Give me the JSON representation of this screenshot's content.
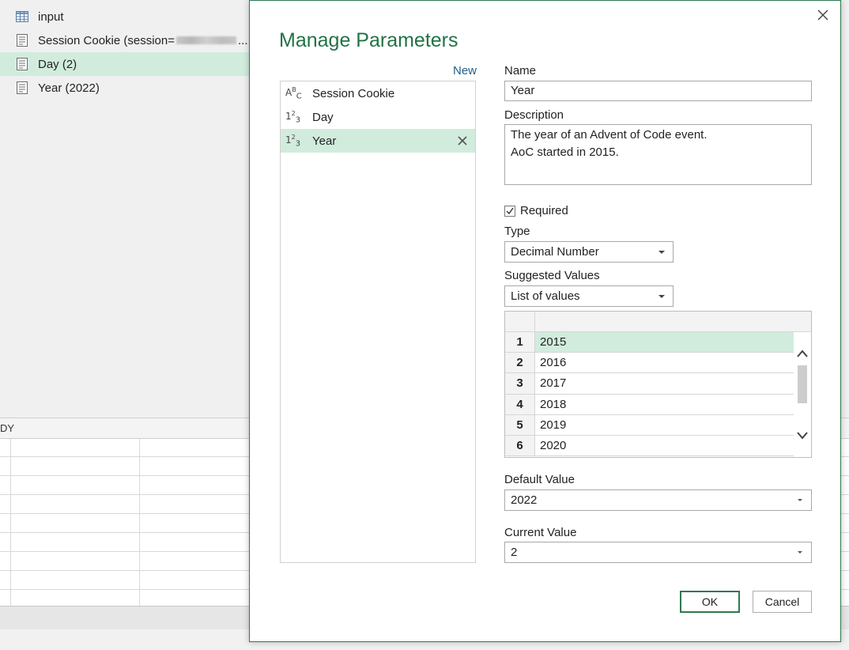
{
  "queries": [
    {
      "label": "input",
      "icon": "table-icon",
      "selected": false
    },
    {
      "label": "Session Cookie (session=",
      "suffix": "...",
      "icon": "parameter-icon",
      "selected": false,
      "blurred": true
    },
    {
      "label": "Day (2)",
      "icon": "parameter-icon",
      "selected": true
    },
    {
      "label": "Year (2022)",
      "icon": "parameter-icon",
      "selected": false
    }
  ],
  "status_text": "DY",
  "dialog": {
    "title": "Manage Parameters",
    "new_link": "New",
    "parameters": [
      {
        "type_icon": "ABC",
        "label": "Session Cookie",
        "selected": false
      },
      {
        "type_icon": "123",
        "label": "Day",
        "selected": false
      },
      {
        "type_icon": "123",
        "label": "Year",
        "selected": true
      }
    ],
    "name_label": "Name",
    "name_value": "Year",
    "description_label": "Description",
    "description_value": "The year of an Advent of Code event.\nAoC started in 2015.",
    "required_label": "Required",
    "required_checked": true,
    "type_label": "Type",
    "type_value": "Decimal Number",
    "suggested_label": "Suggested Values",
    "suggested_value": "List of values",
    "values": [
      {
        "num": "1",
        "value": "2015",
        "selected": true
      },
      {
        "num": "2",
        "value": "2016",
        "selected": false
      },
      {
        "num": "3",
        "value": "2017",
        "selected": false
      },
      {
        "num": "4",
        "value": "2018",
        "selected": false
      },
      {
        "num": "5",
        "value": "2019",
        "selected": false
      },
      {
        "num": "6",
        "value": "2020",
        "selected": false
      }
    ],
    "default_label": "Default Value",
    "default_value": "2022",
    "current_label": "Current Value",
    "current_value": "2",
    "ok_label": "OK",
    "cancel_label": "Cancel"
  },
  "colors": {
    "accent": "#217346",
    "selection": "#d1ecdd",
    "link": "#1f5f8a"
  }
}
